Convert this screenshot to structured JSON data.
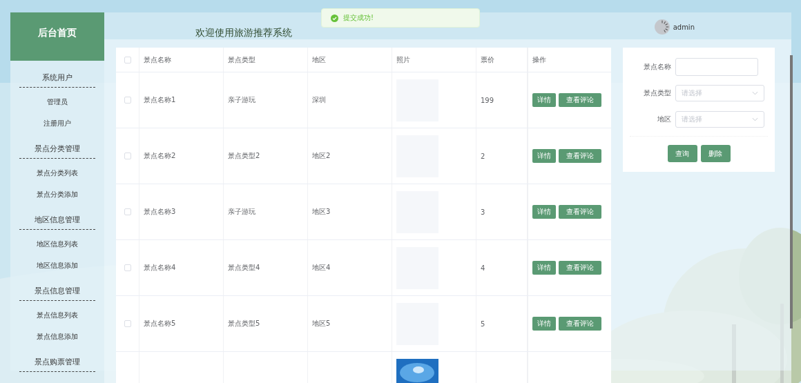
{
  "toast": {
    "kind": "success",
    "text": "提交成功!"
  },
  "sidebar": {
    "title": "后台首页",
    "groups": [
      {
        "title": "系统用户",
        "items": [
          "管理员",
          "注册用户"
        ]
      },
      {
        "title": "景点分类管理",
        "items": [
          "景点分类列表",
          "景点分类添加"
        ]
      },
      {
        "title": "地区信息管理",
        "items": [
          "地区信息列表",
          "地区信息添加"
        ]
      },
      {
        "title": "景点信息管理",
        "items": [
          "景点信息列表",
          "景点信息添加"
        ]
      },
      {
        "title": "景点购票管理"
      }
    ]
  },
  "header": {
    "title": "欢迎使用旅游推荐系统",
    "user": "admin"
  },
  "table": {
    "select_all_checked": false,
    "columns": [
      "景点名称",
      "景点类型",
      "地区",
      "照片",
      "票价",
      "操作"
    ],
    "rows": [
      {
        "checked": false,
        "name": "景点名称1",
        "type": "亲子游玩",
        "region": "深圳",
        "photo": {
          "kind": "blank"
        },
        "price": "199",
        "actions": [
          "详情",
          "查看评论"
        ]
      },
      {
        "checked": false,
        "name": "景点名称2",
        "type": "景点类型2",
        "region": "地区2",
        "photo": {
          "kind": "blank"
        },
        "price": "2",
        "actions": [
          "详情",
          "查看评论"
        ]
      },
      {
        "checked": false,
        "name": "景点名称3",
        "type": "亲子游玩",
        "region": "地区3",
        "photo": {
          "kind": "blank"
        },
        "price": "3",
        "actions": [
          "详情",
          "查看评论"
        ]
      },
      {
        "checked": false,
        "name": "景点名称4",
        "type": "景点类型4",
        "region": "地区4",
        "photo": {
          "kind": "blank"
        },
        "price": "4",
        "actions": [
          "详情",
          "查看评论"
        ]
      },
      {
        "checked": false,
        "name": "景点名称5",
        "type": "景点类型5",
        "region": "地区5",
        "photo": {
          "kind": "blank"
        },
        "price": "5",
        "actions": [
          "详情",
          "查看评论"
        ]
      },
      {
        "photo": {
          "kind": "picture"
        }
      }
    ]
  },
  "search": {
    "fields": [
      {
        "kind": "input",
        "label": "景点名称"
      },
      {
        "kind": "select",
        "label": "景点类型",
        "placeholder": "请选择"
      },
      {
        "kind": "select",
        "label": "地区",
        "placeholder": "请选择"
      }
    ],
    "buttons": [
      "查询",
      "删除"
    ]
  }
}
